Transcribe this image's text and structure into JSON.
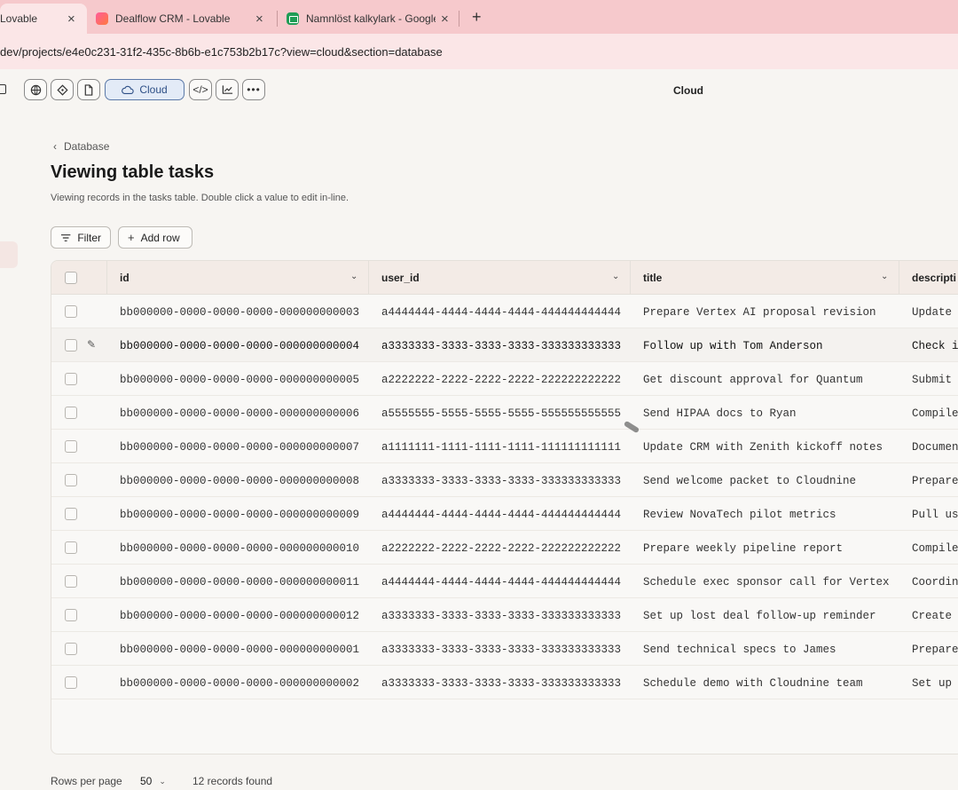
{
  "browser": {
    "tabs": [
      {
        "label": "Lovable",
        "favicon": "lovable-icon",
        "active": true
      },
      {
        "label": "Dealflow CRM - Lovable",
        "favicon": "lovable-icon",
        "active": false
      },
      {
        "label": "Namnlöst kalkylark - Google",
        "favicon": "sheets-icon",
        "active": false
      }
    ],
    "close_glyph": "×",
    "new_tab_glyph": "+",
    "url": "dev/projects/e4e0c231-31f2-435c-8b6b-e1c753b2b17c?view=cloud&section=database"
  },
  "toolbar": {
    "cloud_label": "Cloud",
    "title": "Cloud"
  },
  "page": {
    "breadcrumb": "Database",
    "title": "Viewing table tasks",
    "subtitle": "Viewing records in the tasks table. Double click a value to edit in-line.",
    "filter_label": "Filter",
    "add_row_label": "Add row"
  },
  "table": {
    "columns": [
      "id",
      "user_id",
      "title",
      "descripti"
    ],
    "rows": [
      {
        "id": "bb000000-0000-0000-0000-000000000003",
        "user_id": "a4444444-4444-4444-4444-444444444444",
        "title": "Prepare Vertex AI proposal revision",
        "description": "Update"
      },
      {
        "id": "bb000000-0000-0000-0000-000000000004",
        "user_id": "a3333333-3333-3333-3333-333333333333",
        "title": "Follow up with Tom Anderson",
        "description": "Check i"
      },
      {
        "id": "bb000000-0000-0000-0000-000000000005",
        "user_id": "a2222222-2222-2222-2222-222222222222",
        "title": "Get discount approval for Quantum",
        "description": "Submit"
      },
      {
        "id": "bb000000-0000-0000-0000-000000000006",
        "user_id": "a5555555-5555-5555-5555-555555555555",
        "title": "Send HIPAA docs to Ryan",
        "description": "Compile"
      },
      {
        "id": "bb000000-0000-0000-0000-000000000007",
        "user_id": "a1111111-1111-1111-1111-111111111111",
        "title": "Update CRM with Zenith kickoff notes",
        "description": "Documen"
      },
      {
        "id": "bb000000-0000-0000-0000-000000000008",
        "user_id": "a3333333-3333-3333-3333-333333333333",
        "title": "Send welcome packet to Cloudnine",
        "description": "Prepare"
      },
      {
        "id": "bb000000-0000-0000-0000-000000000009",
        "user_id": "a4444444-4444-4444-4444-444444444444",
        "title": "Review NovaTech pilot metrics",
        "description": "Pull us"
      },
      {
        "id": "bb000000-0000-0000-0000-000000000010",
        "user_id": "a2222222-2222-2222-2222-222222222222",
        "title": "Prepare weekly pipeline report",
        "description": "Compile"
      },
      {
        "id": "bb000000-0000-0000-0000-000000000011",
        "user_id": "a4444444-4444-4444-4444-444444444444",
        "title": "Schedule exec sponsor call for Vertex",
        "description": "Coordin"
      },
      {
        "id": "bb000000-0000-0000-0000-000000000012",
        "user_id": "a3333333-3333-3333-3333-333333333333",
        "title": "Set up lost deal follow-up reminder",
        "description": "Create"
      },
      {
        "id": "bb000000-0000-0000-0000-000000000001",
        "user_id": "a3333333-3333-3333-3333-333333333333",
        "title": "Send technical specs to James",
        "description": "Prepare"
      },
      {
        "id": "bb000000-0000-0000-0000-000000000002",
        "user_id": "a3333333-3333-3333-3333-333333333333",
        "title": "Schedule demo with Cloudnine team",
        "description": "Set up"
      }
    ]
  },
  "footer": {
    "rows_per_page_label": "Rows per page",
    "rows_per_page_value": "50",
    "records_found": "12 records found"
  }
}
